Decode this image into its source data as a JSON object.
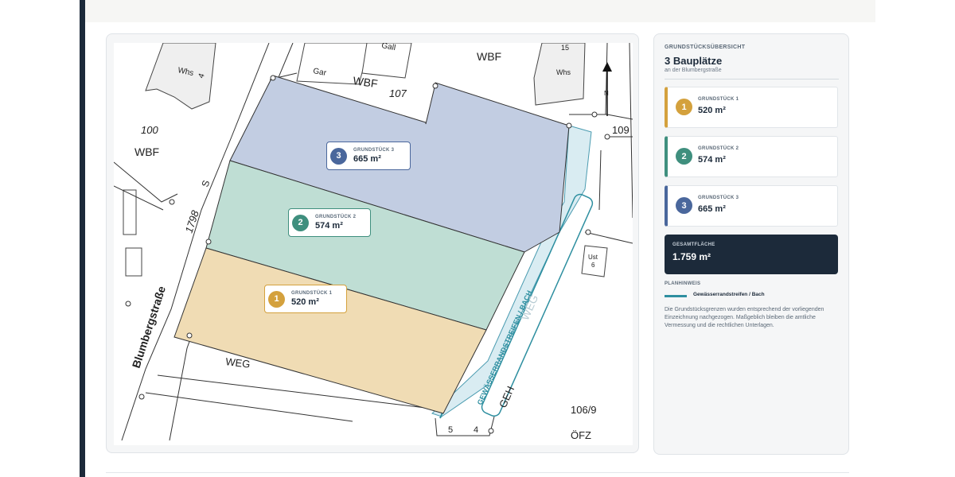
{
  "map": {
    "labels": {
      "whs_left": "Whs",
      "four": "4",
      "gar": "Gar",
      "wbf_top": "WBF",
      "num_107": "107",
      "wbf_right": "WBF",
      "num_15": "15",
      "whs_right": "Whs",
      "num_100": "100",
      "wbf_left": "WBF",
      "num_109": "109",
      "num_1798": "1798",
      "s_mark": "S",
      "street": "Blumbergstraße",
      "weg": "WEG",
      "gewaesser": "GEWÄSSERRANDSTREIFEN / BACH",
      "weg_faded": "WEG",
      "geh": "GEH",
      "num_1069": "106/9",
      "oefz": "ÖFZ",
      "ust": "Ust",
      "six": "6",
      "n_arrow": "N",
      "small5": "5",
      "small4": "4",
      "gall": "Gall"
    }
  },
  "plots": [
    {
      "number": "1",
      "caption": "GRUNDSTÜCK 1",
      "area": "520 m²",
      "color": "#d4a13d"
    },
    {
      "number": "2",
      "caption": "GRUNDSTÜCK 2",
      "area": "574 m²",
      "color": "#3f8f7e"
    },
    {
      "number": "3",
      "caption": "GRUNDSTÜCK 3",
      "area": "665 m²",
      "color": "#4a679c"
    }
  ],
  "sidebar": {
    "overline": "GRUNDSTÜCKSÜBERSICHT",
    "title": "3 Bauplätze",
    "subtitle": "an der Blumbergstraße",
    "total_caption": "GESAMTFLÄCHE",
    "total_value": "1.759 m²",
    "note_title": "PLANHINWEIS",
    "legend_label": "Gewässerrandstreifen / Bach",
    "description": "Die Grundstücksgrenzen wurden entsprechend der vorliegenden Einzeichnung nachgezogen. Maßgeblich bleiben die amtliche Vermessung und die rechtlichen Unterlagen."
  },
  "colors": {
    "navy": "#1c2a3a",
    "stream": "#2e8fa0",
    "plot1_fill": "#f0dcb4",
    "plot2_fill": "#bfded4",
    "plot3_fill": "#c2cde2"
  }
}
